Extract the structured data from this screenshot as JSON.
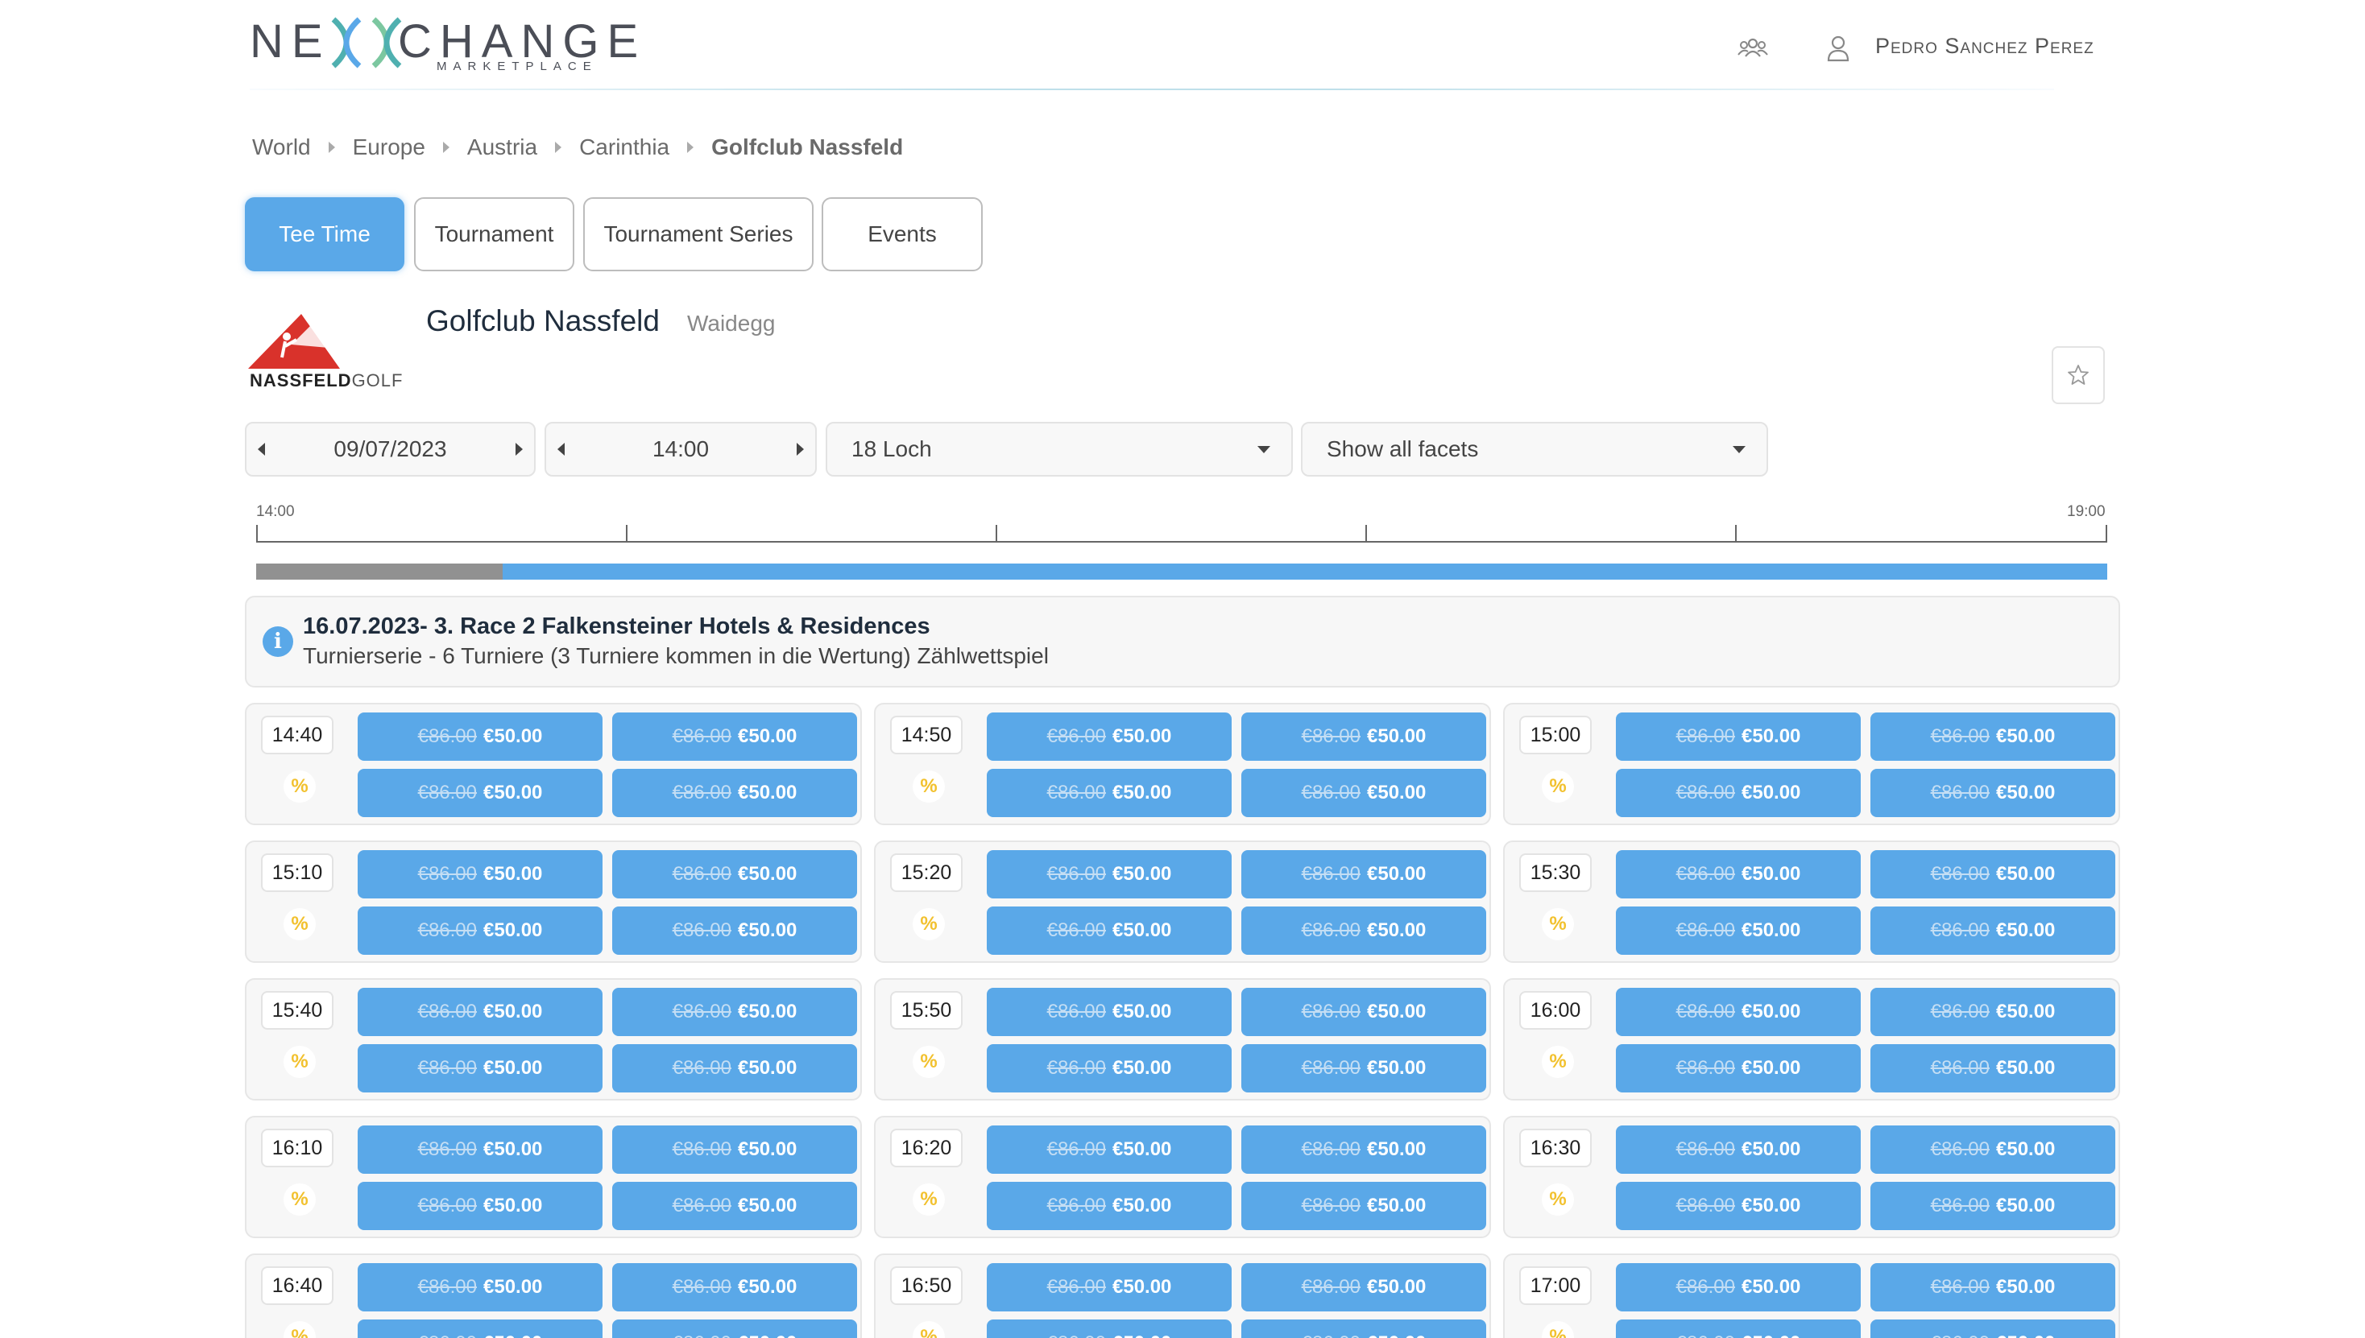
{
  "header": {
    "logo": {
      "left": "NE",
      "right": "CHANGE",
      "sub": "MARKETPLACE"
    },
    "user_name": "Pedro Sanchez Perez"
  },
  "breadcrumb": [
    "World",
    "Europe",
    "Austria",
    "Carinthia",
    "Golfclub Nassfeld"
  ],
  "tabs": [
    {
      "label": "Tee Time",
      "active": true
    },
    {
      "label": "Tournament",
      "active": false
    },
    {
      "label": "Tournament Series",
      "active": false
    },
    {
      "label": "Events",
      "active": false
    }
  ],
  "club": {
    "name": "Golfclub Nassfeld",
    "location": "Waidegg",
    "logo_text_bold": "NASSFELD",
    "logo_text_light": "GOLF"
  },
  "controls": {
    "date": "09/07/2023",
    "time": "14:00",
    "holes": "18 Loch",
    "facets": "Show all facets"
  },
  "timeline": {
    "start": "14:00",
    "end": "19:00",
    "elapsed_fraction": 0.133
  },
  "info": {
    "title": "16.07.2023- 3. Race 2 Falkensteiner Hotels & Residences",
    "subtitle": "Turnierserie - 6 Turniere (3 Turniere kommen in die Wertung) Zählwettspiel"
  },
  "price": {
    "old": "€86.00",
    "new": "€50.00"
  },
  "slots": [
    {
      "time": "14:40"
    },
    {
      "time": "14:50"
    },
    {
      "time": "15:00"
    },
    {
      "time": "15:10"
    },
    {
      "time": "15:20"
    },
    {
      "time": "15:30"
    },
    {
      "time": "15:40"
    },
    {
      "time": "15:50"
    },
    {
      "time": "16:00"
    },
    {
      "time": "16:10"
    },
    {
      "time": "16:20"
    },
    {
      "time": "16:30"
    },
    {
      "time": "16:40"
    },
    {
      "time": "16:50"
    },
    {
      "time": "17:00"
    }
  ],
  "colors": {
    "accent": "#5aa8e8",
    "discount": "#f2c12e",
    "timeline_elapsed": "#919191"
  },
  "icons": {
    "group": "group-icon",
    "user": "user-icon",
    "favorite": "star-icon",
    "info": "info-icon",
    "discount": "percent-icon"
  }
}
